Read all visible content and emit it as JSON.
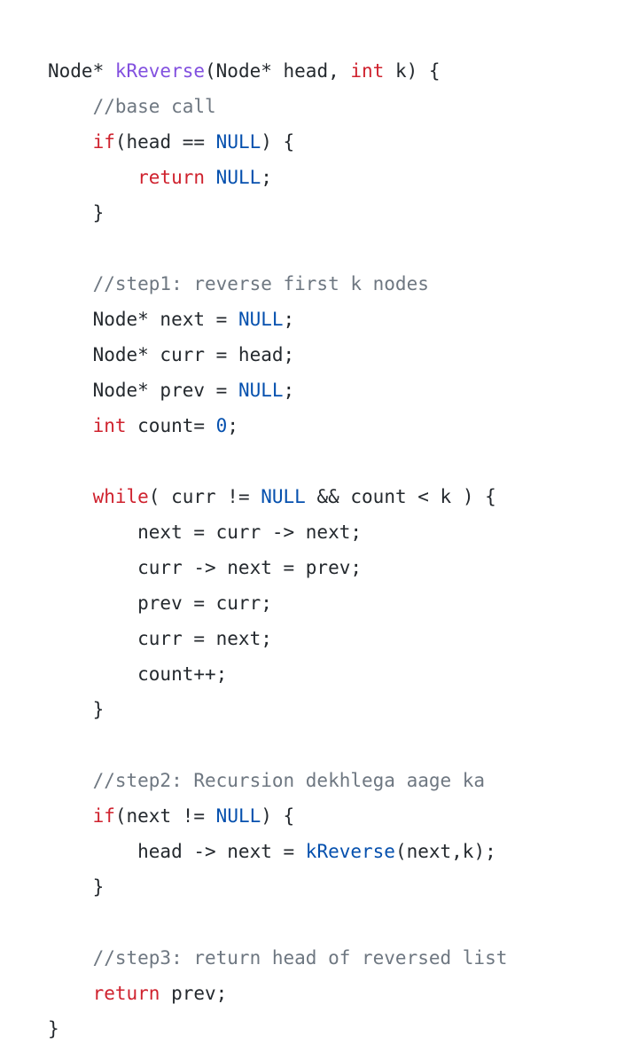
{
  "colors": {
    "keyword": "#cf222e",
    "constant": "#0550ae",
    "function_decl": "#8250df",
    "comment": "#6e7781",
    "text": "#24292e",
    "background": "#ffffff"
  },
  "code": {
    "language": "cpp",
    "lines": [
      [
        {
          "t": "plain",
          "s": "Node* "
        },
        {
          "t": "fndecl",
          "s": "kReverse"
        },
        {
          "t": "plain",
          "s": "(Node* head, "
        },
        {
          "t": "kw",
          "s": "int"
        },
        {
          "t": "plain",
          "s": " k) {"
        }
      ],
      [
        {
          "t": "cm",
          "s": "    //base call"
        }
      ],
      [
        {
          "t": "plain",
          "s": "    "
        },
        {
          "t": "kw",
          "s": "if"
        },
        {
          "t": "plain",
          "s": "(head == "
        },
        {
          "t": "fn",
          "s": "NULL"
        },
        {
          "t": "plain",
          "s": ") {"
        }
      ],
      [
        {
          "t": "plain",
          "s": "        "
        },
        {
          "t": "kw",
          "s": "return"
        },
        {
          "t": "plain",
          "s": " "
        },
        {
          "t": "fn",
          "s": "NULL"
        },
        {
          "t": "plain",
          "s": ";"
        }
      ],
      [
        {
          "t": "plain",
          "s": "    }"
        }
      ],
      [
        {
          "t": "plain",
          "s": ""
        }
      ],
      [
        {
          "t": "cm",
          "s": "    //step1: reverse first k nodes"
        }
      ],
      [
        {
          "t": "plain",
          "s": "    Node* next = "
        },
        {
          "t": "fn",
          "s": "NULL"
        },
        {
          "t": "plain",
          "s": ";"
        }
      ],
      [
        {
          "t": "plain",
          "s": "    Node* curr = head;"
        }
      ],
      [
        {
          "t": "plain",
          "s": "    Node* prev = "
        },
        {
          "t": "fn",
          "s": "NULL"
        },
        {
          "t": "plain",
          "s": ";"
        }
      ],
      [
        {
          "t": "plain",
          "s": "    "
        },
        {
          "t": "kw",
          "s": "int"
        },
        {
          "t": "plain",
          "s": " count= "
        },
        {
          "t": "num",
          "s": "0"
        },
        {
          "t": "plain",
          "s": ";"
        }
      ],
      [
        {
          "t": "plain",
          "s": ""
        }
      ],
      [
        {
          "t": "plain",
          "s": "    "
        },
        {
          "t": "kw",
          "s": "while"
        },
        {
          "t": "plain",
          "s": "( curr != "
        },
        {
          "t": "fn",
          "s": "NULL"
        },
        {
          "t": "plain",
          "s": " && count < k ) {"
        }
      ],
      [
        {
          "t": "plain",
          "s": "        next = curr -> next;"
        }
      ],
      [
        {
          "t": "plain",
          "s": "        curr -> next = prev;"
        }
      ],
      [
        {
          "t": "plain",
          "s": "        prev = curr;"
        }
      ],
      [
        {
          "t": "plain",
          "s": "        curr = next;"
        }
      ],
      [
        {
          "t": "plain",
          "s": "        count++;"
        }
      ],
      [
        {
          "t": "plain",
          "s": "    }"
        }
      ],
      [
        {
          "t": "plain",
          "s": ""
        }
      ],
      [
        {
          "t": "cm",
          "s": "    //step2: Recursion dekhlega aage ka"
        }
      ],
      [
        {
          "t": "plain",
          "s": "    "
        },
        {
          "t": "kw",
          "s": "if"
        },
        {
          "t": "plain",
          "s": "(next != "
        },
        {
          "t": "fn",
          "s": "NULL"
        },
        {
          "t": "plain",
          "s": ") {"
        }
      ],
      [
        {
          "t": "plain",
          "s": "        head -> next = "
        },
        {
          "t": "fn",
          "s": "kReverse"
        },
        {
          "t": "plain",
          "s": "(next,k);"
        }
      ],
      [
        {
          "t": "plain",
          "s": "    }"
        }
      ],
      [
        {
          "t": "plain",
          "s": ""
        }
      ],
      [
        {
          "t": "cm",
          "s": "    //step3: return head of reversed list"
        }
      ],
      [
        {
          "t": "plain",
          "s": "    "
        },
        {
          "t": "kw",
          "s": "return"
        },
        {
          "t": "plain",
          "s": " prev;"
        }
      ],
      [
        {
          "t": "plain",
          "s": "}"
        }
      ]
    ]
  }
}
